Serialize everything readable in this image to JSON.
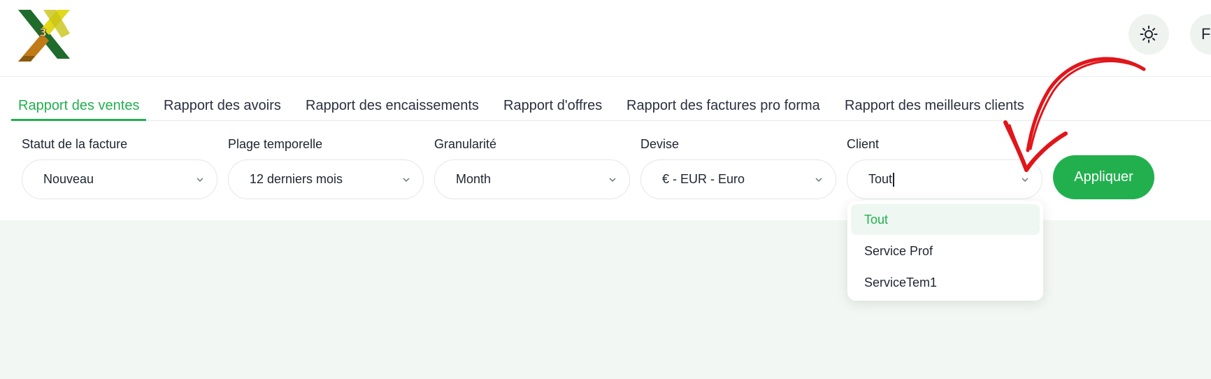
{
  "header": {
    "avatar_initial": "F",
    "theme_icon": "sun-icon"
  },
  "tabs": [
    {
      "label": "Rapport des ventes",
      "active": true
    },
    {
      "label": "Rapport des avoirs",
      "active": false
    },
    {
      "label": "Rapport des encaissements",
      "active": false
    },
    {
      "label": "Rapport d'offres",
      "active": false
    },
    {
      "label": "Rapport des factures pro forma",
      "active": false
    },
    {
      "label": "Rapport des meilleurs clients",
      "active": false
    }
  ],
  "filters": {
    "status": {
      "label": "Statut de la facture",
      "value": "Nouveau"
    },
    "period": {
      "label": "Plage temporelle",
      "value": "12 derniers mois"
    },
    "granularity": {
      "label": "Granularité",
      "value": "Month"
    },
    "currency": {
      "label": "Devise",
      "value": "€ - EUR - Euro"
    },
    "client": {
      "label": "Client",
      "value": "Tout"
    }
  },
  "apply_label": "Appliquer",
  "client_options": [
    {
      "label": "Tout",
      "selected": true
    },
    {
      "label": "Service Prof",
      "selected": false
    },
    {
      "label": "ServiceTem1",
      "selected": false
    }
  ],
  "colors": {
    "accent": "#22b04f",
    "annotation_arrow": "#e0161b",
    "background": "#f2f7f4"
  }
}
